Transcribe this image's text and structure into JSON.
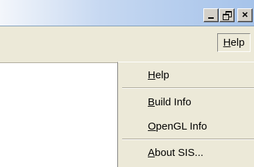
{
  "window": {
    "minimize_glyph": "_",
    "close_glyph": "×"
  },
  "menubar": {
    "help": {
      "prefix": "",
      "mnemonic": "H",
      "rest": "elp"
    }
  },
  "menu": {
    "items": [
      {
        "prefix": "",
        "mnemonic": "H",
        "rest": "elp"
      },
      {
        "prefix": "",
        "mnemonic": "B",
        "rest": "uild Info"
      },
      {
        "prefix": "",
        "mnemonic": "O",
        "rest": "penGL Info"
      },
      {
        "prefix": "",
        "mnemonic": "A",
        "rest": "bout SIS..."
      }
    ]
  },
  "colors": {
    "titlebar_gradient_end": "#a6c3ea",
    "menu_background": "#ece9d8",
    "button_face": "#d4d0c8"
  }
}
